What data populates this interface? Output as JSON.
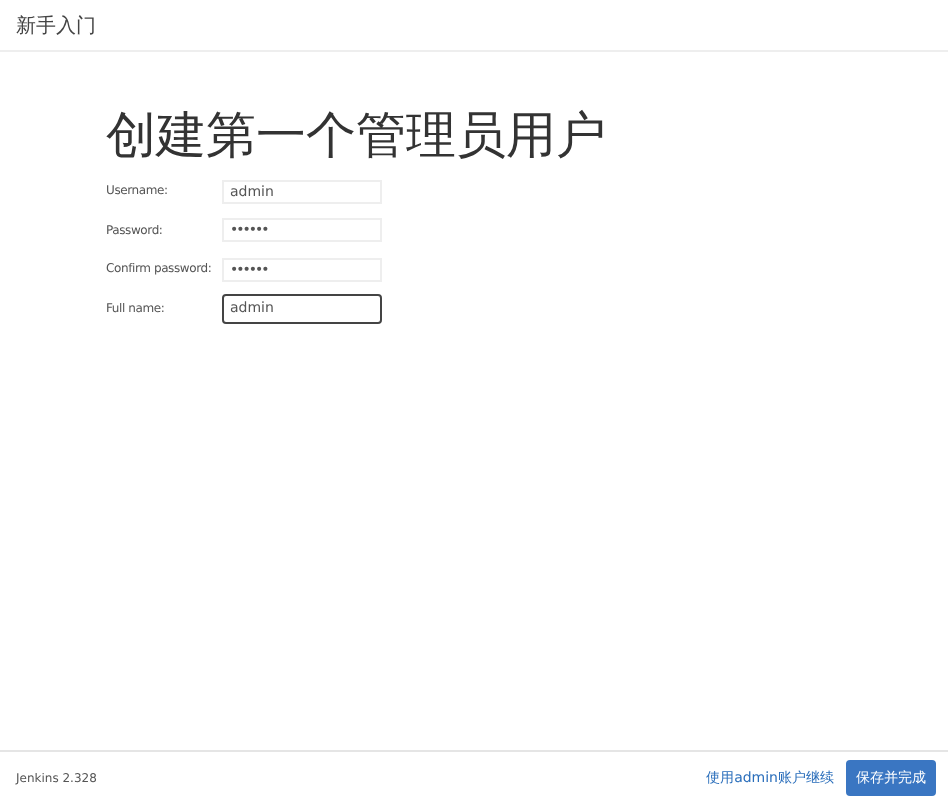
{
  "header": {
    "title": "新手入门"
  },
  "heading": "创建第一个管理员用户",
  "fields": [
    {
      "label": "Username:",
      "value": "admin",
      "kind": "text",
      "focused": false
    },
    {
      "label": "Password:",
      "value": "••••••",
      "kind": "password",
      "focused": false
    },
    {
      "label": "Confirm password:",
      "value": "••••••",
      "kind": "password",
      "focused": false
    },
    {
      "label": "Full name:",
      "value": "admin",
      "kind": "text",
      "focused": true
    }
  ],
  "footer": {
    "version": "Jenkins 2.328",
    "link": "使用admin账户继续",
    "button": "保存并完成"
  }
}
